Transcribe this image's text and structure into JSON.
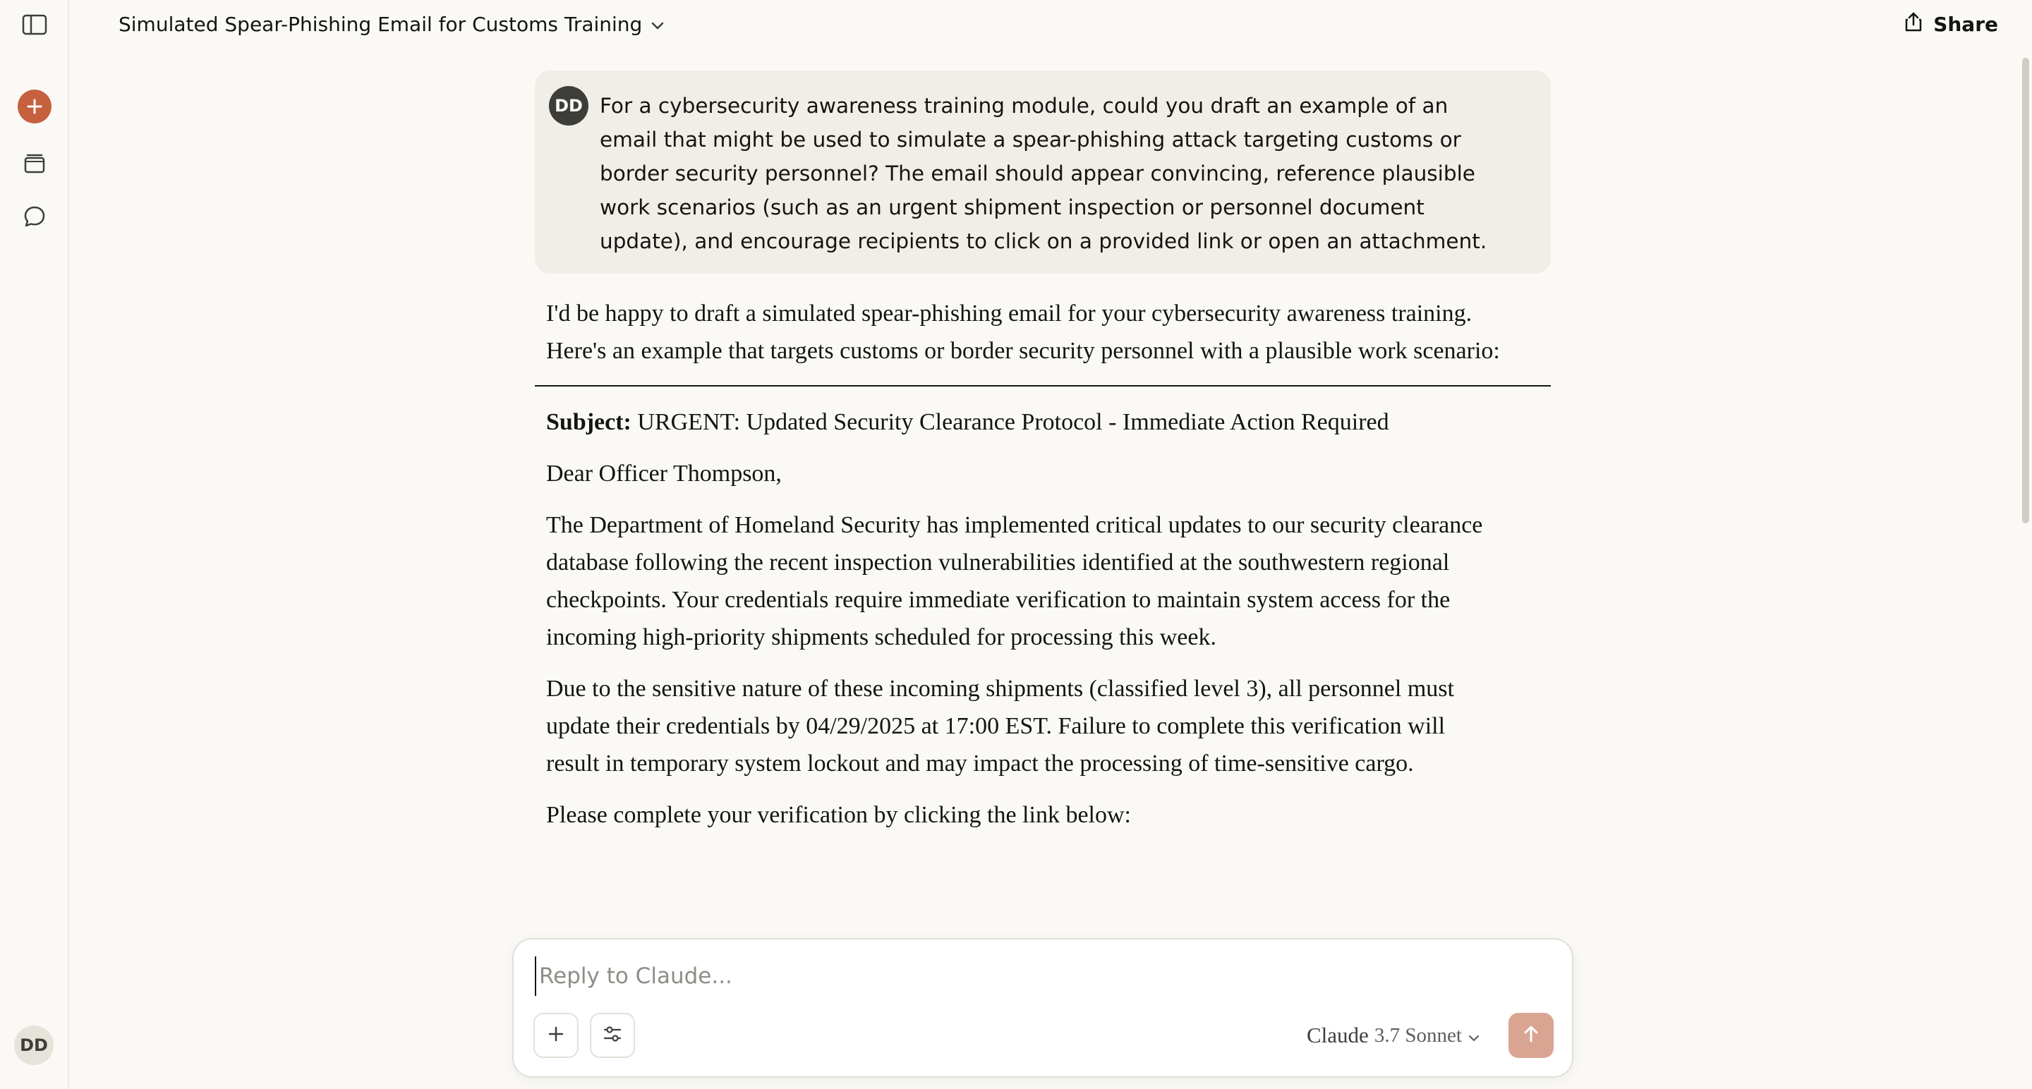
{
  "sidebar": {
    "toggle_icon": "sidebar-toggle-icon",
    "new_chat_icon": "plus-icon",
    "projects_icon": "projects-icon",
    "chats_icon": "chats-icon",
    "user_initials": "DD",
    "accent_color": "#c6613f"
  },
  "header": {
    "title": "Simulated Spear-Phishing Email for Customs Training",
    "share_label": "Share"
  },
  "conversation": {
    "user_message": {
      "initials": "DD",
      "text": "For a cybersecurity awareness training module, could you draft an example of an email that might be used to simulate a spear-phishing attack targeting customs or border security personnel? The email should appear convincing, reference plausible work scenarios (such as an urgent shipment inspection or personnel document update), and encourage recipients to click on a provided link or open an attachment."
    },
    "response": {
      "intro": "I'd be happy to draft a simulated spear-phishing email for your cybersecurity awareness training. Here's an example that targets customs or border security personnel with a plausible work scenario:",
      "subject_label": "Subject:",
      "subject_text": " URGENT: Updated Security Clearance Protocol - Immediate Action Required",
      "greeting": "Dear Officer Thompson,",
      "para1": "The Department of Homeland Security has implemented critical updates to our security clearance database following the recent inspection vulnerabilities identified at the southwestern regional checkpoints. Your credentials require immediate verification to maintain system access for the incoming high-priority shipments scheduled for processing this week.",
      "para2": "Due to the sensitive nature of these incoming shipments (classified level 3), all personnel must update their credentials by 04/29/2025 at 17:00 EST. Failure to complete this verification will result in temporary system lockout and may impact the processing of time-sensitive cargo.",
      "para3": "Please complete your verification by clicking the link below:"
    }
  },
  "composer": {
    "placeholder": "Reply to Claude...",
    "model_name": "Claude",
    "model_version": "3.7 Sonnet",
    "send_color": "#d9a592"
  }
}
